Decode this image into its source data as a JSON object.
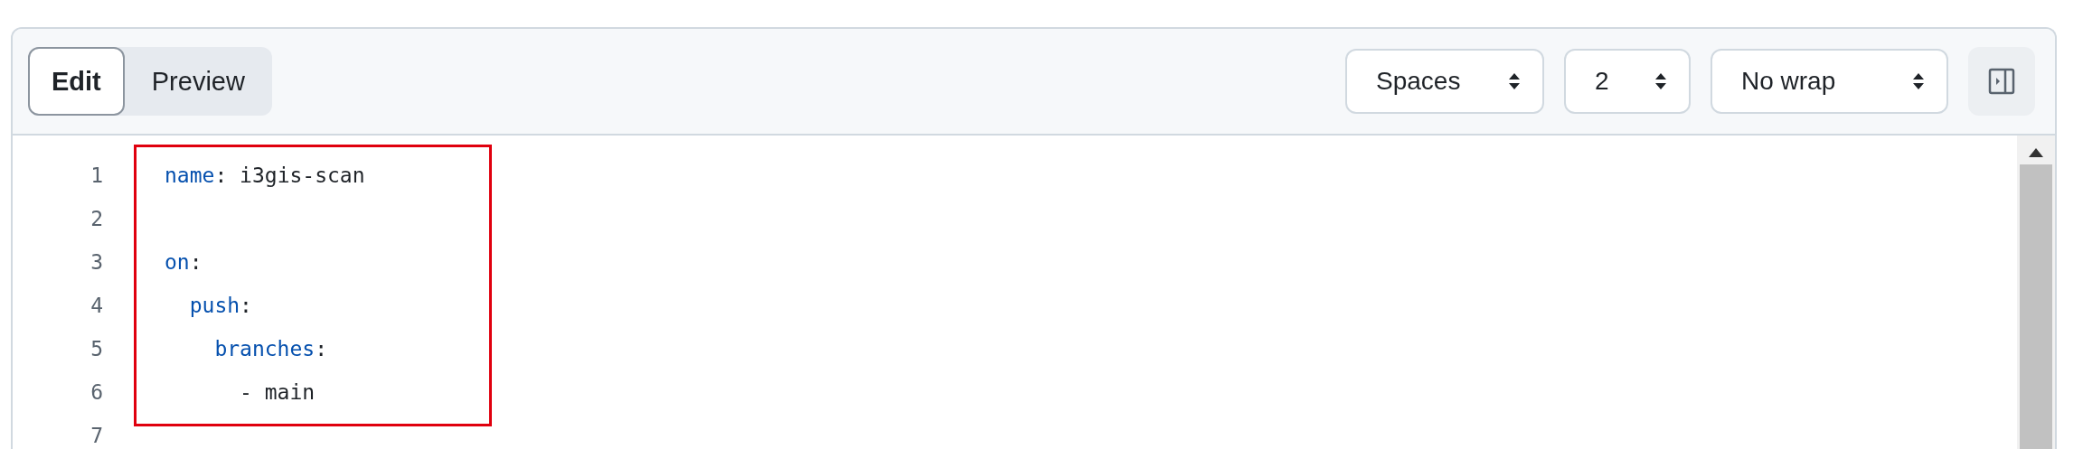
{
  "tabs": [
    {
      "label": "Edit",
      "selected": true
    },
    {
      "label": "Preview",
      "selected": false
    }
  ],
  "selects": [
    {
      "value": "Spaces"
    },
    {
      "value": "2"
    },
    {
      "value": "No wrap"
    }
  ],
  "lines": [
    {
      "number": "1",
      "tokens": [
        {
          "text": "name",
          "kind": "key"
        },
        {
          "text": ": i3gis-scan",
          "kind": "plain"
        }
      ]
    },
    {
      "number": "2"
    },
    {
      "number": "3",
      "tokens": [
        {
          "text": "on",
          "kind": "key"
        },
        {
          "text": ":",
          "kind": "plain"
        }
      ]
    },
    {
      "number": "4",
      "tokens": [
        {
          "text": "  push",
          "kind": "key"
        },
        {
          "text": ":",
          "kind": "plain"
        }
      ]
    },
    {
      "number": "5",
      "tokens": [
        {
          "text": "    branches",
          "kind": "key"
        },
        {
          "text": ":",
          "kind": "plain"
        }
      ]
    },
    {
      "number": "6",
      "tokens": [
        {
          "text": "      - main",
          "kind": "plain"
        }
      ]
    },
    {
      "number": "7"
    }
  ]
}
